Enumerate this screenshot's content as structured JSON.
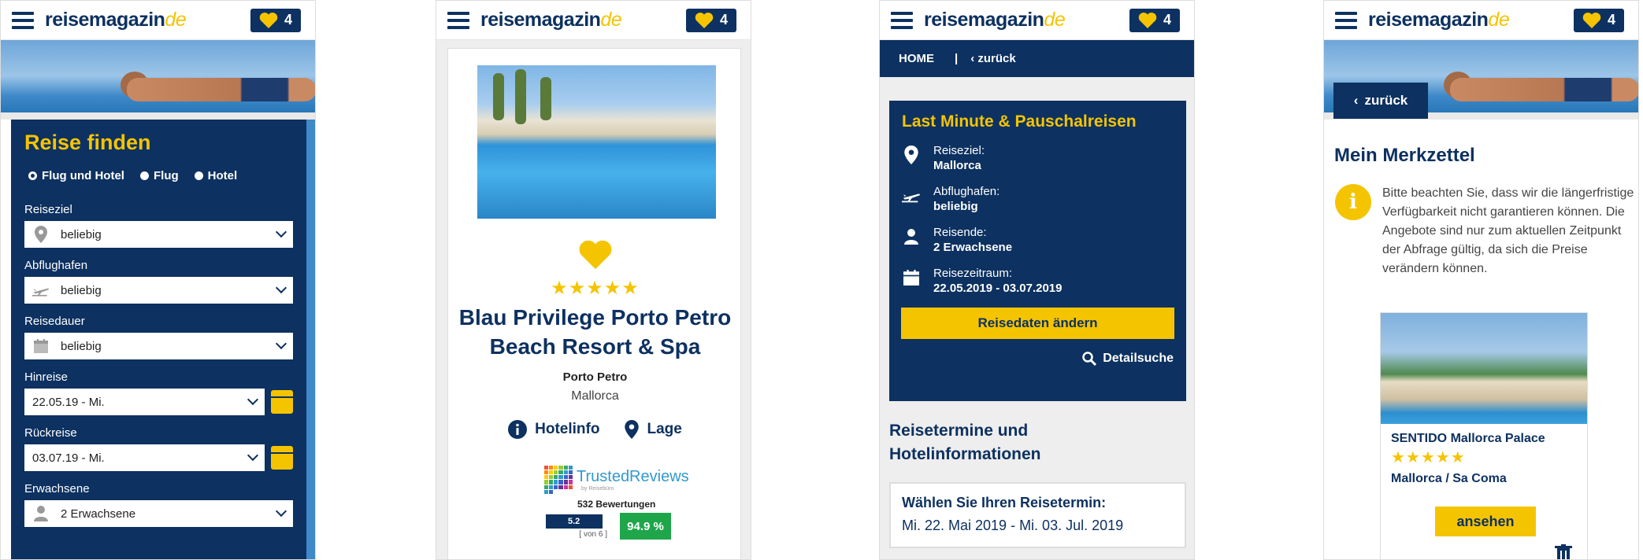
{
  "header": {
    "logo_main": "reisemagazin",
    "logo_tld": "de",
    "fav_count": "4"
  },
  "screen1": {
    "title": "Reise finden",
    "radios": [
      {
        "label": "Flug und Hotel",
        "selected": true
      },
      {
        "label": "Flug",
        "selected": false
      },
      {
        "label": "Hotel",
        "selected": false
      }
    ],
    "fields": {
      "reiseziel_label": "Reiseziel",
      "reiseziel_value": "beliebig",
      "abflughafen_label": "Abflughafen",
      "abflughafen_value": "beliebig",
      "reisedauer_label": "Reisedauer",
      "reisedauer_value": "beliebig",
      "hinreise_label": "Hinreise",
      "hinreise_value": "22.05.19 - Mi.",
      "rueckreise_label": "Rückreise",
      "rueckreise_value": "03.07.19 - Mi.",
      "erwachsene_label": "Erwachsene",
      "erwachsene_value": "2 Erwachsene"
    }
  },
  "screen2": {
    "stars": "★★★★★",
    "hotel_name_line1": "Blau Privilege Porto Petro",
    "hotel_name_line2": "Beach Resort & Spa",
    "city": "Porto Petro",
    "region": "Mallorca",
    "hotelinfo_label": "Hotelinfo",
    "lage_label": "Lage",
    "trusted_brand": "TrustedReviews",
    "trusted_sub": "by Reisebüro",
    "reviews_count": "532 Bewertungen",
    "score": "5.2",
    "score_of": "[ von 6 ]",
    "recommend": "94.9 %"
  },
  "screen3": {
    "nav_home": "HOME",
    "nav_sep": "|",
    "nav_back": "zurück",
    "box_title": "Last Minute & Pauschalreisen",
    "info": [
      {
        "label": "Reiseziel:",
        "value": "Mallorca",
        "icon": "location-pin-icon"
      },
      {
        "label": "Abflughafen:",
        "value": "beliebig",
        "icon": "plane-icon"
      },
      {
        "label": "Reisende:",
        "value": "2 Erwachsene",
        "icon": "person-icon"
      },
      {
        "label": "Reisezeitraum:",
        "value": "22.05.2019 - 03.07.2019",
        "icon": "calendar-icon"
      }
    ],
    "change_button": "Reisedaten ändern",
    "detail_search": "Detailsuche",
    "section_title_line1": "Reisetermine und",
    "section_title_line2": "Hotelinformationen",
    "termin_title": "Wählen Sie Ihren Reisetermin:",
    "termin_value": "Mi. 22. Mai 2019 - Mi. 03. Jul. 2019"
  },
  "screen4": {
    "back_label": "zurück",
    "title": "Mein Merkzettel",
    "note": "Bitte beachten Sie, dass wir die längerfristige Verfügbarkeit nicht garantieren können. Die Angebote sind nur zum aktuellen Zeitpunkt der Abfrage gültig, da sich die Preise verändern können.",
    "hotel_name": "SENTIDO Mallorca Palace",
    "stars": "★★★★★",
    "location": "Mallorca / Sa Coma",
    "view_button": "ansehen"
  },
  "colors": {
    "navy": "#0d3160",
    "yellow": "#f5c400",
    "green": "#1fa64b"
  }
}
